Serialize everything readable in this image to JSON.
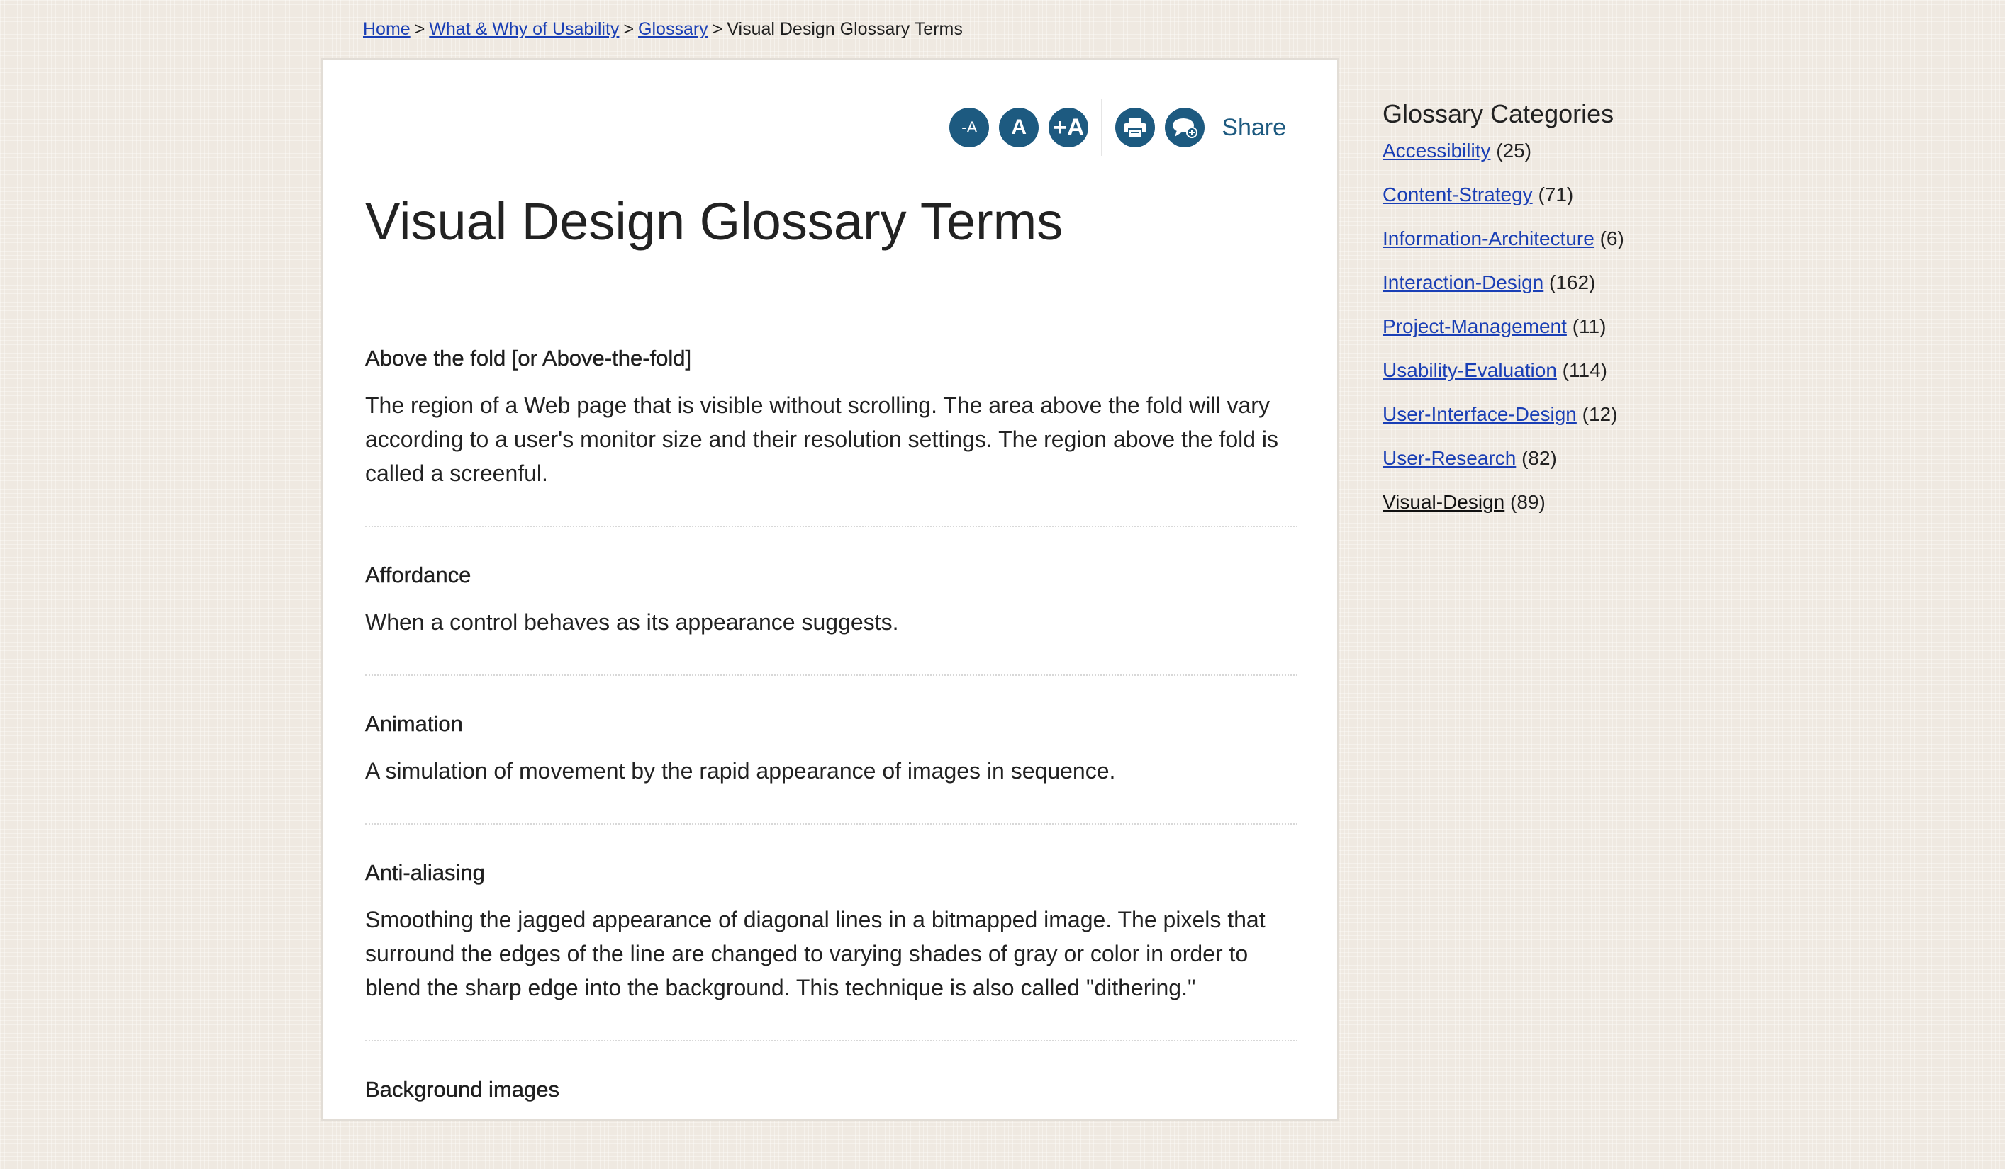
{
  "breadcrumb": {
    "items": [
      {
        "label": "Home"
      },
      {
        "label": "What & Why of Usability"
      },
      {
        "label": "Glossary"
      }
    ],
    "current": "Visual Design Glossary Terms",
    "separator": ">"
  },
  "toolbar": {
    "decrease_font_label": "-A",
    "normal_font_label": "A",
    "increase_font_label": "+A",
    "share_label": "Share",
    "icons": [
      "print-icon",
      "comment-icon"
    ]
  },
  "page_title": "Visual Design Glossary Terms",
  "terms": [
    {
      "title": "Above the fold [or Above-the-fold]",
      "definition": "The region of a Web page that is visible without scrolling. The area above the fold will vary according to a user's monitor size and their resolution settings. The region above the fold is called a screenful."
    },
    {
      "title": "Affordance",
      "definition": "When a control behaves as its appearance suggests."
    },
    {
      "title": "Animation",
      "definition": "A simulation of movement by the rapid appearance of images in sequence."
    },
    {
      "title": "Anti-aliasing",
      "definition": "Smoothing the jagged appearance of diagonal lines in a bitmapped image. The pixels that surround the edges of the line are changed to varying shades of gray or color in order to blend the sharp edge into the background. This technique is also called \"dithering.\""
    },
    {
      "title": "Background images",
      "definition": ""
    }
  ],
  "sidebar": {
    "title": "Glossary Categories",
    "categories": [
      {
        "label": "Accessibility",
        "count": "(25)"
      },
      {
        "label": "Content-Strategy",
        "count": "(71)"
      },
      {
        "label": "Information-Architecture",
        "count": "(6)"
      },
      {
        "label": "Interaction-Design",
        "count": "(162)"
      },
      {
        "label": "Project-Management",
        "count": "(11)"
      },
      {
        "label": "Usability-Evaluation",
        "count": "(114)"
      },
      {
        "label": "User-Interface-Design",
        "count": "(12)"
      },
      {
        "label": "User-Research",
        "count": "(82)"
      },
      {
        "label": "Visual-Design",
        "count": "(89)"
      }
    ]
  },
  "colors": {
    "link": "#1a3fb5",
    "button": "#1d5a80",
    "background": "#efe9e1",
    "panel": "#ffffff"
  }
}
